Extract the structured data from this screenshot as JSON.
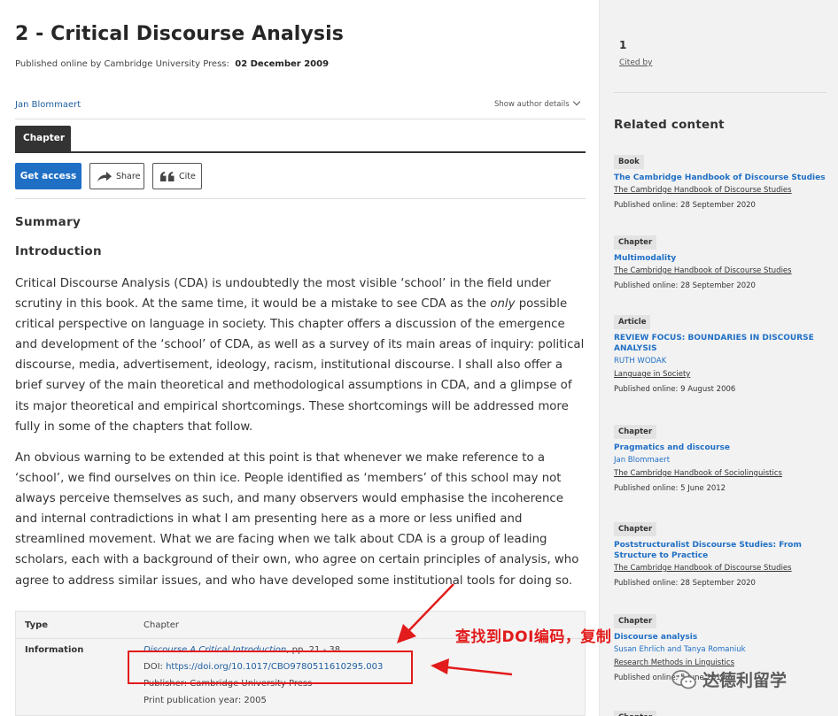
{
  "header": {
    "title": "2 - Critical Discourse Analysis",
    "published_prefix": "Published online by Cambridge University Press:",
    "published_date": "02 December 2009",
    "author": "Jan Blommaert",
    "show_author_details": "Show author details"
  },
  "tabs": [
    "Chapter"
  ],
  "actions": {
    "get_access": "Get access",
    "share": "Share",
    "cite": "Cite"
  },
  "summary_heading": "Summary",
  "intro_heading": "Introduction",
  "paragraphs": {
    "p1_a": "Critical Discourse Analysis (CDA) is undoubtedly the most visible ‘school’ in the field under scrutiny in this book. At the same time, it would be a mistake to see CDA as the ",
    "p1_em": "only",
    "p1_b": " possible critical perspective on language in society. This chapter offers a discussion of the emergence and development of the ‘school’ of CDA, as well as a survey of its main areas of inquiry: political discourse, media, advertisement, ideology, racism, institutional discourse. I shall also offer a brief survey of the main theoretical and methodological assumptions in CDA, and a glimpse of its major theoretical and empirical shortcomings. These shortcomings will be addressed more fully in some of the chapters that follow.",
    "p2": "An obvious warning to be extended at this point is that whenever we make reference to a ‘school’, we find ourselves on thin ice. People identified as ‘members’ of this school may not always perceive themselves as such, and many observers would emphasise the incoherence and internal contradictions in what I am presenting here as a more or less unified and streamlined movement. What we are facing when we talk about CDA is a group of leading scholars, each with a background of their own, who agree on certain principles of analysis, who agree to address similar issues, and who have developed some institutional tools for doing so."
  },
  "info": {
    "type_label": "Type",
    "type_value": "Chapter",
    "information_label": "Information",
    "book_link": "Discourse A Critical Introduction",
    "pages": ", pp. 21 - 38",
    "doi_label": "DOI:",
    "doi_url": "https://doi.org/10.1017/CBO9780511610295.003",
    "publisher": "Publisher: Cambridge University Press",
    "print_year": "Print publication year: 2005"
  },
  "annotation": "查找到DOI编码，复制",
  "watermark": "达德利留学",
  "sidebar": {
    "cited_count": "1",
    "cited_by": "Cited by",
    "related_heading": "Related content",
    "items": [
      {
        "type": "Book",
        "title": "The Cambridge Handbook of Discourse Studies",
        "author": "",
        "source": "The Cambridge Handbook of Discourse Studies",
        "date": "Published online: 28 September 2020"
      },
      {
        "type": "Chapter",
        "title": "Multimodality",
        "author": "",
        "source": "The Cambridge Handbook of Discourse Studies",
        "date": "Published online: 28 September 2020"
      },
      {
        "type": "Article",
        "title": "REVIEW FOCUS: BOUNDARIES IN DISCOURSE ANALYSIS",
        "author": "RUTH WODAK",
        "source": "Language in Society",
        "date": "Published online: 9 August 2006"
      },
      {
        "type": "Chapter",
        "title": "Pragmatics and discourse",
        "author": "Jan Blommaert",
        "source": "The Cambridge Handbook of Sociolinguistics",
        "date": "Published online: 5 June 2012"
      },
      {
        "type": "Chapter",
        "title": "Poststructuralist Discourse Studies: From Structure to Practice",
        "author": "",
        "source": "The Cambridge Handbook of Discourse Studies",
        "date": "Published online: 28 September 2020"
      },
      {
        "type": "Chapter",
        "title": "Discourse analysis",
        "author": "Susan Ehrlich and Tanya Romaniuk",
        "source": "Research Methods in Linguistics",
        "date": "Published online: 5 June 2014"
      },
      {
        "type": "Chapter",
        "title": "",
        "author": "",
        "source": "",
        "date": ""
      }
    ]
  },
  "colors": {
    "accent": "#1f6fc5",
    "annotation_red": "#e21b1b",
    "tab_dark": "#333333"
  }
}
